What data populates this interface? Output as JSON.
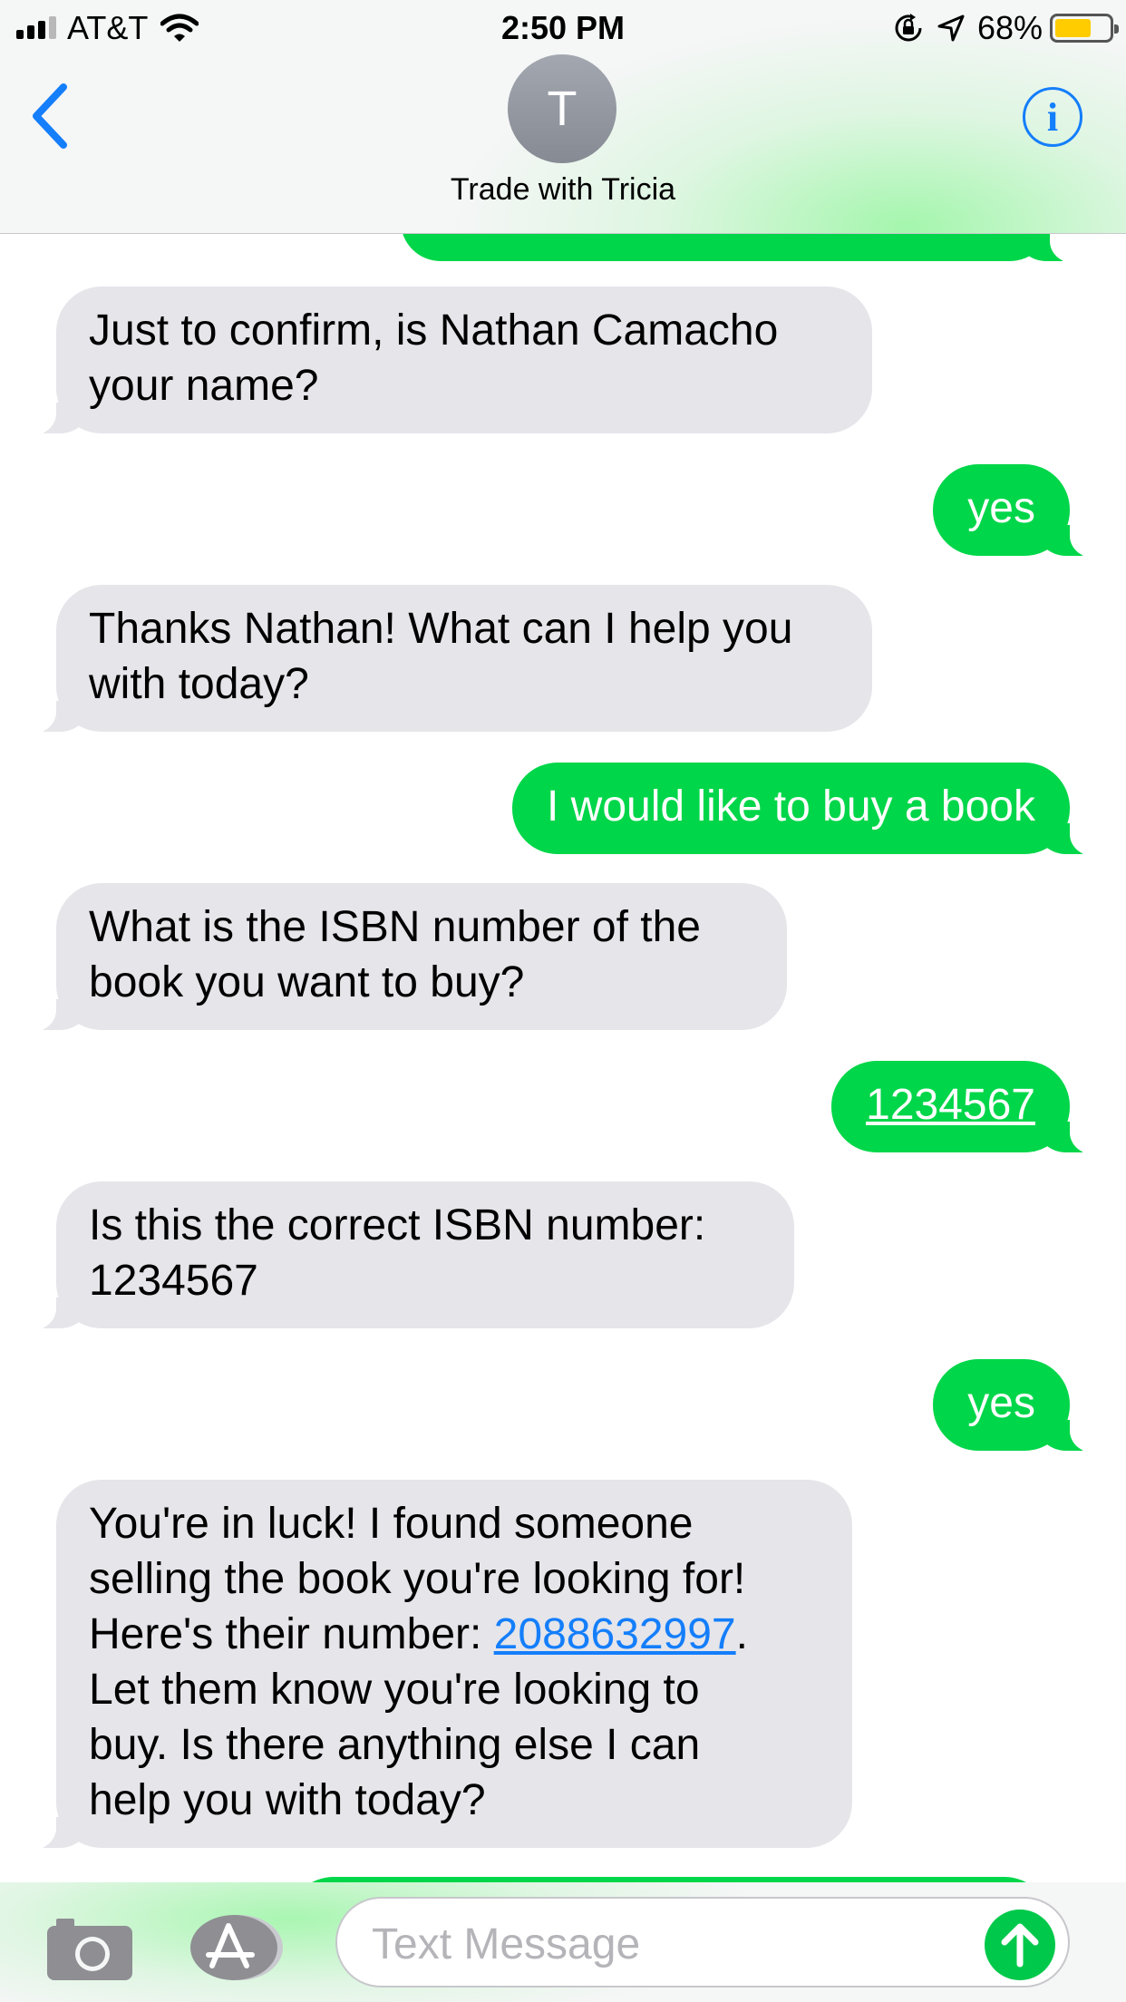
{
  "status_bar": {
    "carrier": "AT&T",
    "time": "2:50 PM",
    "battery_percent": "68%",
    "battery_level": 0.68,
    "signal_bars": 3,
    "icons": [
      "wifi-icon",
      "orientation-lock-icon",
      "location-arrow-icon",
      "battery-icon"
    ]
  },
  "header": {
    "avatar_initial": "T",
    "contact_name": "Trade with Tricia",
    "icons": [
      "back-chevron-icon",
      "info-icon"
    ]
  },
  "messages": [
    {
      "from": "them",
      "text": "Just to confirm, is Nathan Camacho\nyour name?"
    },
    {
      "from": "me",
      "text": "yes"
    },
    {
      "from": "them",
      "text": "Thanks Nathan! What can I help you\nwith today?"
    },
    {
      "from": "me",
      "text": "I would like to buy a book"
    },
    {
      "from": "them",
      "text": "What is the ISBN number of the\nbook you want to buy?"
    },
    {
      "from": "me",
      "text": "1234567"
    },
    {
      "from": "them",
      "text": "Is this the correct ISBN number:\n1234567"
    },
    {
      "from": "me",
      "text": "yes"
    },
    {
      "from": "them",
      "text_before": "You're in luck! I found someone\nselling the book you're looking for!\nHere's their number: ",
      "link_text": "2088632997",
      "text_after": ".\nLet them know you're looking to\nbuy. Is there anything else I can\nhelp you with today?"
    }
  ],
  "composer": {
    "placeholder": "Text Message",
    "icons": [
      "camera-icon",
      "app-store-icon",
      "send-arrow-icon"
    ]
  },
  "colors": {
    "outgoing_bubble": "#00d649",
    "incoming_bubble": "#e5e5ea",
    "link_blue": "#147efb",
    "header_background": "#f5f6f6"
  }
}
